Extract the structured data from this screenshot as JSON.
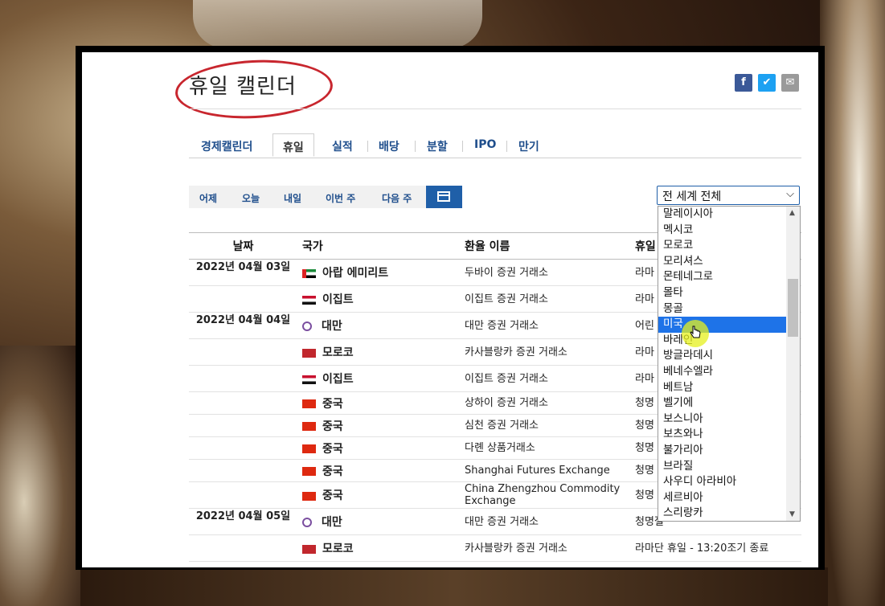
{
  "page_title": "휴일 캘린더",
  "tabs": [
    "경제캘린더",
    "휴일",
    "실적",
    "배당",
    "분할",
    "IPO",
    "만기"
  ],
  "filters": [
    "어제",
    "오늘",
    "내일",
    "이번 주",
    "다음 주"
  ],
  "region_select": "전 세계 전체",
  "table": {
    "headers": [
      "날짜",
      "국가",
      "환율 이름",
      "휴일"
    ],
    "rows": [
      {
        "date": "2022년 04월 03일",
        "country": "아랍 에미리트",
        "exchange": "두바이 증권 거래소",
        "holiday": "라마"
      },
      {
        "date": "",
        "country": "이집트",
        "exchange": "이집트 증권 거래소",
        "holiday": "라마 료"
      },
      {
        "date": "2022년 04월 04일",
        "country": "대만",
        "exchange": "대만 증권 거래소",
        "holiday": "어린"
      },
      {
        "date": "",
        "country": "모로코",
        "exchange": "카사블랑카 증권 거래소",
        "holiday": "라마 료"
      },
      {
        "date": "",
        "country": "이집트",
        "exchange": "이집트 증권 거래소",
        "holiday": "라마 료"
      },
      {
        "date": "",
        "country": "중국",
        "exchange": "상하이 증권 거래소",
        "holiday": "청명"
      },
      {
        "date": "",
        "country": "중국",
        "exchange": "심천 증권 거래소",
        "holiday": "청명"
      },
      {
        "date": "",
        "country": "중국",
        "exchange": "다롄 상품거래소",
        "holiday": "청명"
      },
      {
        "date": "",
        "country": "중국",
        "exchange": "Shanghai Futures Exchange",
        "holiday": "청명"
      },
      {
        "date": "",
        "country": "중국",
        "exchange": "China Zhengzhou Commodity Exchange",
        "holiday": "청명"
      },
      {
        "date": "2022년 04월 05일",
        "country": "대만",
        "exchange": "대만 증권 거래소",
        "holiday": "청명절"
      },
      {
        "date": "",
        "country": "모로코",
        "exchange": "카사블랑카 증권 거래소",
        "holiday": "라마단 휴일 - 13:20조기 종료"
      }
    ]
  },
  "dropdown_options": [
    "말레이시아",
    "멕시코",
    "모로코",
    "모리셔스",
    "몬테네그로",
    "몰타",
    "몽골",
    "미국",
    "바레인",
    "방글라데시",
    "베네수엘라",
    "베트남",
    "벨기에",
    "보스니아",
    "보츠와나",
    "불가리아",
    "브라질",
    "사우디 아라비아",
    "세르비아",
    "스리랑카"
  ],
  "dropdown_selected": "미국",
  "accent_color": "#1f5fa8",
  "highlight_color": "#c8262e"
}
